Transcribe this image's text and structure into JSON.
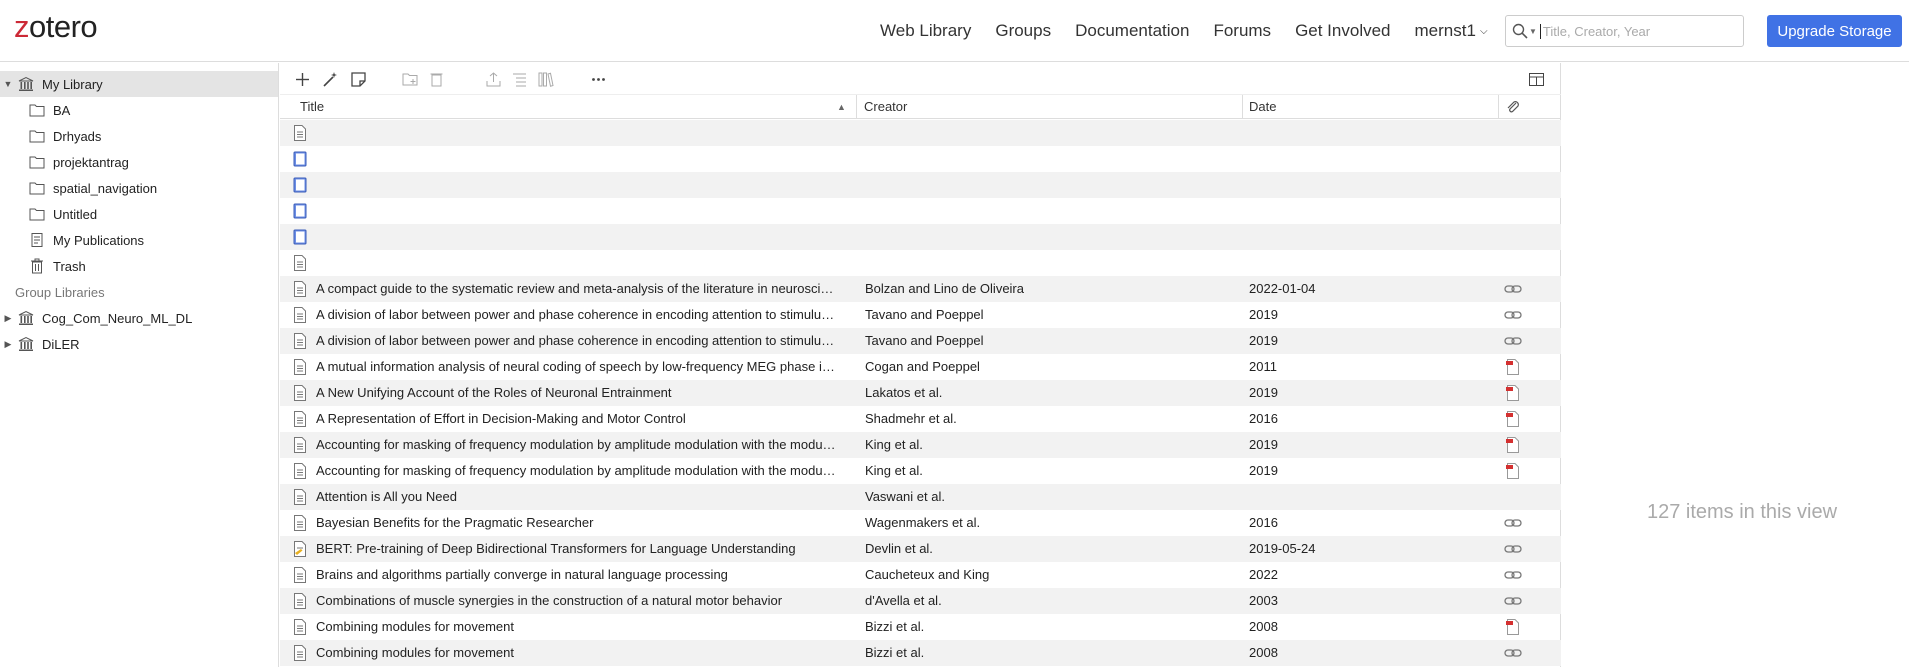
{
  "app": {
    "logo_accent": "z",
    "logo_rest": "otero"
  },
  "nav": {
    "items": [
      "Web Library",
      "Groups",
      "Documentation",
      "Forums",
      "Get Involved"
    ],
    "user": "mernst1"
  },
  "search": {
    "placeholder": "Title, Creator, Year"
  },
  "upgrade_label": "Upgrade Storage",
  "colors": {
    "accent": "#4072e5",
    "brand_red": "#cc2936",
    "selected_bg": "#e4e4e4"
  },
  "sidebar": {
    "library": "My Library",
    "collections": [
      "BA",
      "Drhyads",
      "projektantrag",
      "spatial_navigation",
      "Untitled"
    ],
    "my_publications": "My Publications",
    "trash": "Trash",
    "group_header": "Group Libraries",
    "groups": [
      "Cog_Com_Neuro_ML_DL",
      "DiLER"
    ]
  },
  "columns": {
    "title": "Title",
    "creator": "Creator",
    "date": "Date"
  },
  "rows": [
    {
      "type": "document",
      "title": "",
      "creator": "",
      "date": "",
      "attachment": ""
    },
    {
      "type": "book",
      "title": "",
      "creator": "",
      "date": "",
      "attachment": ""
    },
    {
      "type": "book",
      "title": "",
      "creator": "",
      "date": "",
      "attachment": ""
    },
    {
      "type": "book",
      "title": "",
      "creator": "",
      "date": "",
      "attachment": ""
    },
    {
      "type": "book",
      "title": "",
      "creator": "",
      "date": "",
      "attachment": ""
    },
    {
      "type": "document",
      "title": "",
      "creator": "",
      "date": "",
      "attachment": ""
    },
    {
      "type": "document",
      "title": "A compact guide to the systematic review and meta-analysis of the literature in neurosci…",
      "creator": "Bolzan and Lino de Oliveira",
      "date": "2022-01-04",
      "attachment": "link"
    },
    {
      "type": "document",
      "title": "A division of labor between power and phase coherence in encoding attention to stimulu…",
      "creator": "Tavano and Poeppel",
      "date": "2019",
      "attachment": "link"
    },
    {
      "type": "document",
      "title": "A division of labor between power and phase coherence in encoding attention to stimulu…",
      "creator": "Tavano and Poeppel",
      "date": "2019",
      "attachment": "link"
    },
    {
      "type": "document",
      "title": "A mutual information analysis of neural coding of speech by low-frequency MEG phase i…",
      "creator": "Cogan and Poeppel",
      "date": "2011",
      "attachment": "pdf"
    },
    {
      "type": "document",
      "title": "A New Unifying Account of the Roles of Neuronal Entrainment",
      "creator": "Lakatos et al.",
      "date": "2019",
      "attachment": "pdf"
    },
    {
      "type": "document",
      "title": "A Representation of Effort in Decision-Making and Motor Control",
      "creator": "Shadmehr et al.",
      "date": "2016",
      "attachment": "pdf"
    },
    {
      "type": "document",
      "title": "Accounting for masking of frequency modulation by amplitude modulation with the modu…",
      "creator": "King et al.",
      "date": "2019",
      "attachment": "pdf"
    },
    {
      "type": "document",
      "title": "Accounting for masking of frequency modulation by amplitude modulation with the modu…",
      "creator": "King et al.",
      "date": "2019",
      "attachment": "pdf"
    },
    {
      "type": "document",
      "title": "Attention is All you Need",
      "creator": "Vaswani et al.",
      "date": "",
      "attachment": ""
    },
    {
      "type": "document",
      "title": "Bayesian Benefits for the Pragmatic Researcher",
      "creator": "Wagenmakers et al.",
      "date": "2016",
      "attachment": "link"
    },
    {
      "type": "preprint",
      "title": "BERT: Pre-training of Deep Bidirectional Transformers for Language Understanding",
      "creator": "Devlin et al.",
      "date": "2019-05-24",
      "attachment": "link"
    },
    {
      "type": "document",
      "title": "Brains and algorithms partially converge in natural language processing",
      "creator": "Caucheteux and King",
      "date": "2022",
      "attachment": "link"
    },
    {
      "type": "document",
      "title": "Combinations of muscle synergies in the construction of a natural motor behavior",
      "creator": "d'Avella et al.",
      "date": "2003",
      "attachment": "link"
    },
    {
      "type": "document",
      "title": "Combining modules for movement",
      "creator": "Bizzi et al.",
      "date": "2008",
      "attachment": "pdf"
    },
    {
      "type": "document",
      "title": "Combining modules for movement",
      "creator": "Bizzi et al.",
      "date": "2008",
      "attachment": "link"
    }
  ],
  "items_count": "127 items in this view"
}
